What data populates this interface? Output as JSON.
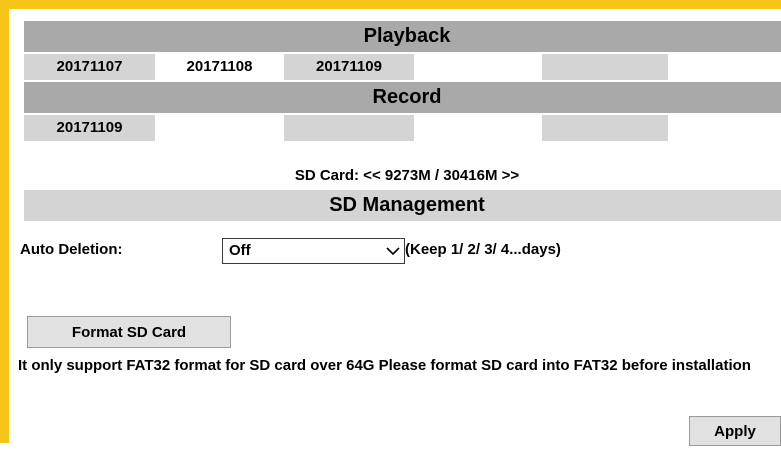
{
  "playback": {
    "title": "Playback",
    "dates": [
      "20171107",
      "20171108",
      "20171109",
      "",
      "",
      ""
    ]
  },
  "record": {
    "title": "Record",
    "dates": [
      "20171109",
      "",
      "",
      "",
      "",
      ""
    ]
  },
  "sd_card": {
    "info": "SD Card: << 9273M / 30416M >>"
  },
  "sd_management": {
    "title": "SD Management",
    "auto_deletion_label": "Auto Deletion:",
    "auto_deletion_value": "Off",
    "keep_hint": "(Keep 1/ 2/ 3/ 4...days)",
    "format_button": "Format SD Card",
    "note": "It only support FAT32 format for SD card over 64G Please format SD card into FAT32 before installation",
    "apply_button": "Apply"
  },
  "colors": {
    "frame": "#f5c518",
    "bar_dark": "#a9a9a9",
    "bar_light": "#d4d4d4"
  },
  "icons": {
    "dropdown": "chevron-down-icon"
  }
}
